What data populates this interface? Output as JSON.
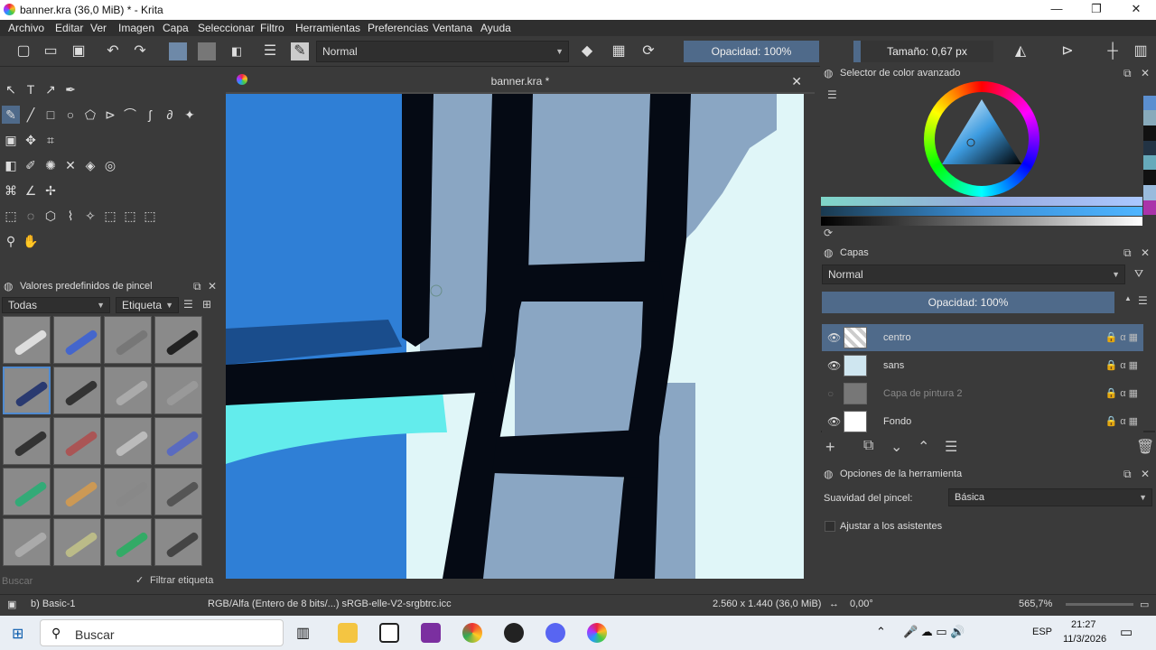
{
  "window": {
    "title": "banner.kra (36,0 MiB)  * - Krita",
    "minimize": "—",
    "restore": "❐",
    "close": "✕"
  },
  "menu": [
    "Archivo",
    "Editar",
    "Ver",
    "Imagen",
    "Capa",
    "Seleccionar",
    "Filtro",
    "Herramientas",
    "Preferencias",
    "Ventana",
    "Ayuda"
  ],
  "toolbar": {
    "blend_mode": "Normal",
    "opacity": "Opacidad: 100%",
    "size": "Tamaño: 0,67 px"
  },
  "document": {
    "tab_title": "banner.kra *",
    "close": "✕"
  },
  "brush_presets": {
    "title": "Valores predefinidos de pincel",
    "filter": "Todas",
    "tag": "Etiqueta",
    "search_placeholder": "Buscar",
    "filter_tag_label": "Filtrar etiqueta"
  },
  "color_selector": {
    "title": "Selector de color avanzado"
  },
  "layers": {
    "title": "Capas",
    "blend_mode": "Normal",
    "opacity": "Opacidad:  100%",
    "items": [
      {
        "name": "centro",
        "active": true
      },
      {
        "name": "sans",
        "active": false
      },
      {
        "name": "Capa de pintura 2",
        "active": false
      },
      {
        "name": "Fondo",
        "active": false
      }
    ]
  },
  "tool_options": {
    "title": "Opciones de la herramienta",
    "smoothing_label": "Suavidad del pincel:",
    "smoothing_value": "Básica",
    "assistants_label": "Ajustar a los asistentes"
  },
  "status": {
    "brush": "b) Basic-1",
    "colorspace": "RGB/Alfa (Entero de 8 bits/...)  sRGB-elle-V2-srgbtrc.icc",
    "dimensions": "2.560 x 1.440 (36,0 MiB)",
    "rotation": "0,00°",
    "zoom": "565,7%"
  },
  "taskbar": {
    "search": "Buscar",
    "time": "21:27",
    "date": "11/3/2026",
    "lang": "ESP"
  }
}
